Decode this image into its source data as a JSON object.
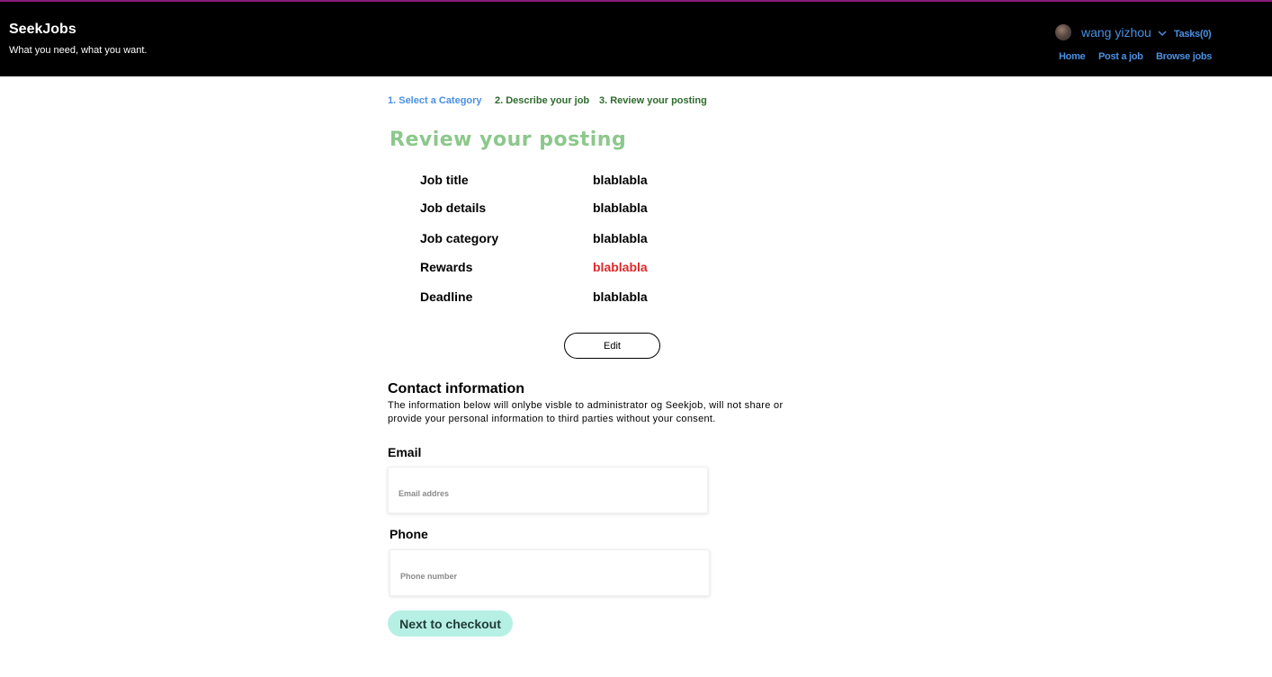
{
  "header": {
    "brand_title": "SeekJobs",
    "tagline": "What you need, what you want.",
    "username": "wang yizhou",
    "tasks_label": "Tasks(0)",
    "nav": {
      "home": "Home",
      "post_job": "Post a job",
      "browse_jobs": "Browse jobs"
    },
    "accent_color": "#4a90e2",
    "icons": {
      "avatar": "user-avatar",
      "dropdown": "chevron-down-icon"
    }
  },
  "steps": {
    "step1": "1. Select a Category",
    "step2": "2. Describe your job",
    "step3": "3. Review your posting"
  },
  "review": {
    "title": "Review your posting",
    "rows": [
      {
        "label": "Job title",
        "value": "blablabla"
      },
      {
        "label": "Job details",
        "value": "blablabla"
      },
      {
        "label": "Job category",
        "value": "blablabla"
      },
      {
        "label": "Rewards",
        "value": "blablabla"
      },
      {
        "label": "Deadline",
        "value": "blablabla"
      }
    ],
    "edit_label": "Edit"
  },
  "contact": {
    "heading": "Contact information",
    "description": "The information below will onlybe visble to administrator og Seekjob, will not share or provide your personal information to third parties without your consent.",
    "email_label": "Email",
    "email_placeholder": "Email addres",
    "email_value": "",
    "phone_label": "Phone",
    "phone_placeholder": "Phone number",
    "phone_value": ""
  },
  "actions": {
    "next_label": "Next to checkout",
    "next_color": "#b6f0e4"
  }
}
